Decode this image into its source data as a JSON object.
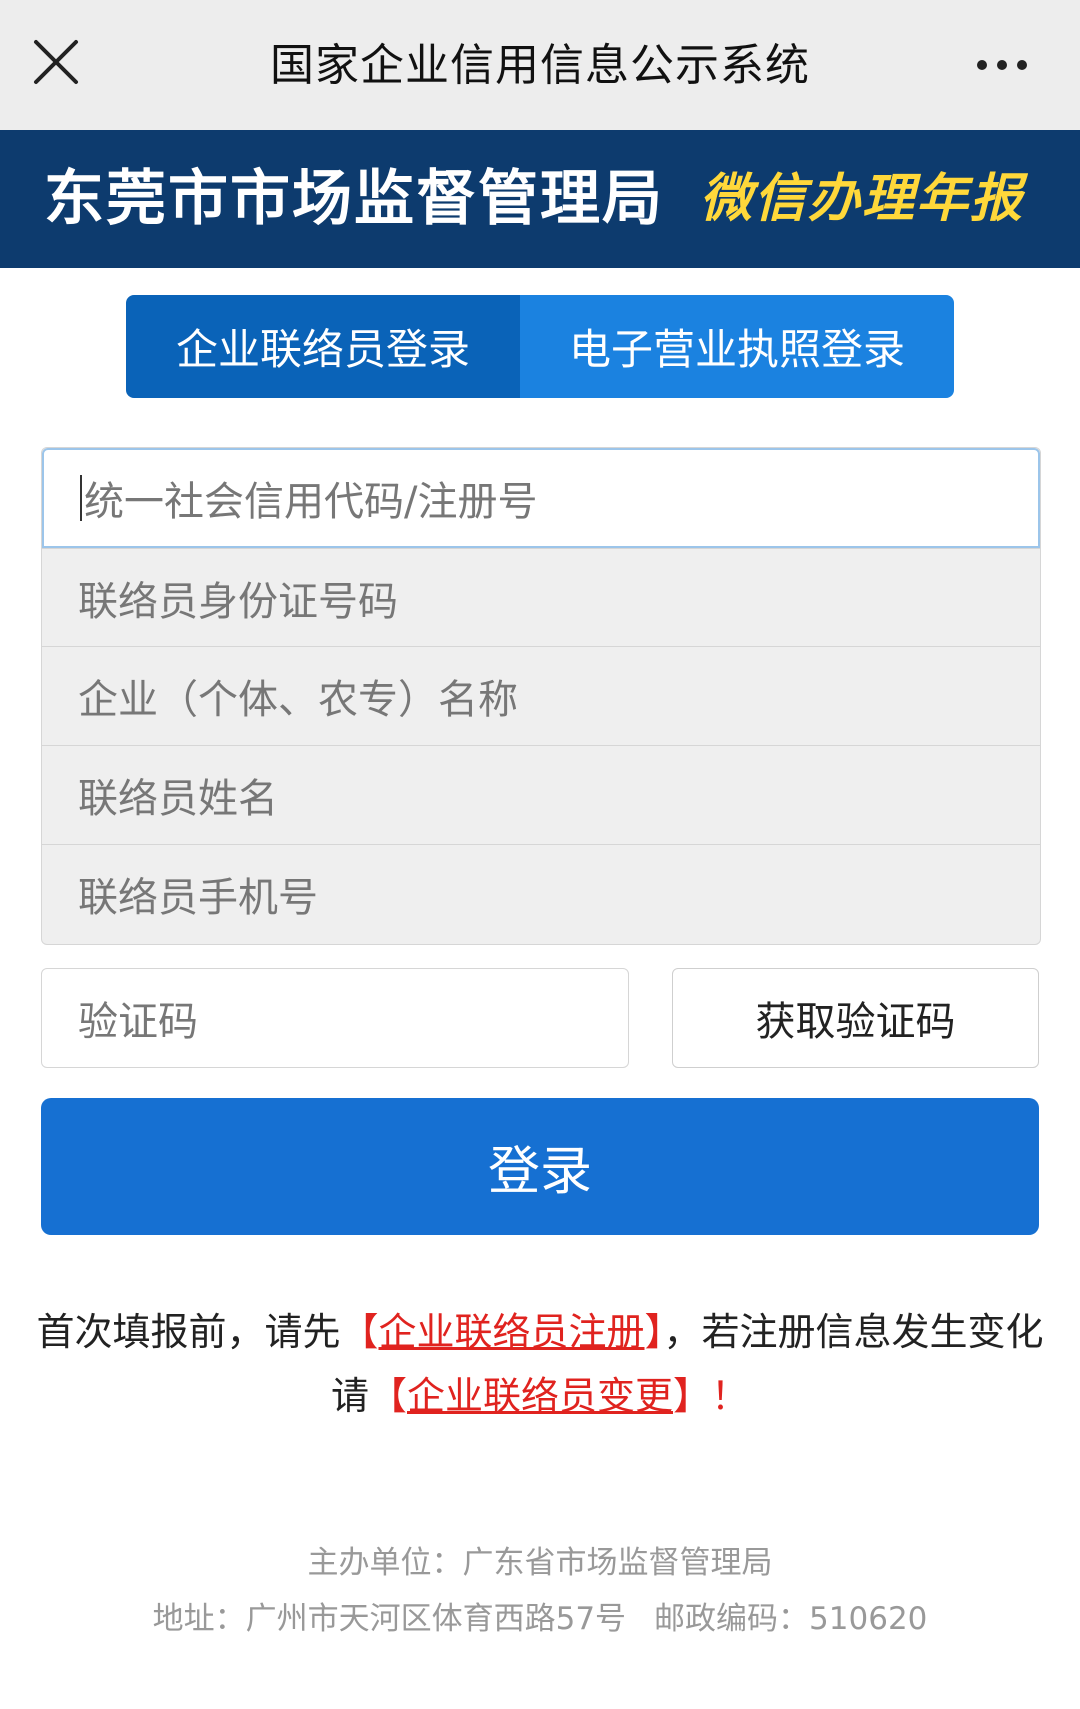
{
  "topbar": {
    "title": "国家企业信用信息公示系统",
    "close_icon": "close-icon",
    "more_icon": "more-horizontal-icon"
  },
  "banner": {
    "title": "东莞市市场监督管理局",
    "slogan": "微信办理年报",
    "background_color": "#0d3b6e",
    "slogan_color": "#ffd83a"
  },
  "tabs": [
    {
      "label": "企业联络员登录",
      "active": true
    },
    {
      "label": "电子营业执照登录",
      "active": false
    }
  ],
  "form": {
    "fields": [
      {
        "placeholder": "统一社会信用代码/注册号",
        "value": ""
      },
      {
        "placeholder": "联络员身份证号码",
        "value": ""
      },
      {
        "placeholder": "企业（个体、农专）名称",
        "value": ""
      },
      {
        "placeholder": "联络员姓名",
        "value": ""
      },
      {
        "placeholder": "联络员手机号",
        "value": ""
      }
    ],
    "code_placeholder": "验证码",
    "get_code_label": "获取验证码",
    "login_label": "登录",
    "accent_color": "#1670d2"
  },
  "notice": {
    "part1": "首次填报前，请先",
    "bracket_open": "【",
    "register_link": "企业联络员注册",
    "bracket_close": "】",
    "part2": "，若注册信息发生变化请",
    "change_link": "企业联络员变更",
    "end": "！",
    "link_color": "#e0231f"
  },
  "footer": {
    "host": "主办单位：广东省市场监督管理局",
    "address": "地址：广州市天河区体育西路57号",
    "postal": "邮政编码：510620"
  }
}
